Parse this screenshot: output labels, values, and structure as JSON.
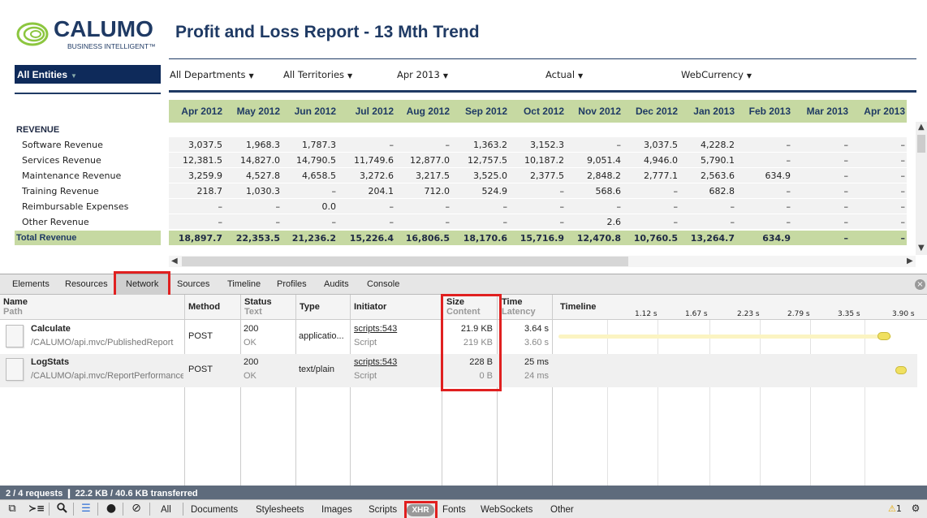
{
  "logo": {
    "word": "CALUMO",
    "sub": "BUSINESS INTELLIGENT™"
  },
  "report": {
    "title": "Profit and Loss Report - 13 Mth Trend",
    "entities": "All Entities",
    "filters": [
      "All Departments",
      "All Territories",
      "Apr 2013",
      "Actual",
      "WebCurrency"
    ],
    "months": [
      "Apr 2012",
      "May 2012",
      "Jun 2012",
      "Jul 2012",
      "Aug 2012",
      "Sep 2012",
      "Oct 2012",
      "Nov 2012",
      "Dec 2012",
      "Jan 2013",
      "Feb 2013",
      "Mar 2013",
      "Apr 2013"
    ],
    "section": "REVENUE",
    "rows": [
      {
        "label": "Software Revenue",
        "values": [
          "3,037.5",
          "1,968.3",
          "1,787.3",
          "–",
          "–",
          "1,363.2",
          "3,152.3",
          "–",
          "3,037.5",
          "4,228.2",
          "–",
          "–",
          "–"
        ]
      },
      {
        "label": "Services Revenue",
        "values": [
          "12,381.5",
          "14,827.0",
          "14,790.5",
          "11,749.6",
          "12,877.0",
          "12,757.5",
          "10,187.2",
          "9,051.4",
          "4,946.0",
          "5,790.1",
          "–",
          "–",
          "–"
        ]
      },
      {
        "label": "Maintenance Revenue",
        "values": [
          "3,259.9",
          "4,527.8",
          "4,658.5",
          "3,272.6",
          "3,217.5",
          "3,525.0",
          "2,377.5",
          "2,848.2",
          "2,777.1",
          "2,563.6",
          "634.9",
          "–",
          "–"
        ]
      },
      {
        "label": "Training Revenue",
        "values": [
          "218.7",
          "1,030.3",
          "–",
          "204.1",
          "712.0",
          "524.9",
          "–",
          "568.6",
          "–",
          "682.8",
          "–",
          "–",
          "–"
        ]
      },
      {
        "label": "Reimbursable Expenses",
        "values": [
          "–",
          "–",
          "0.0",
          "–",
          "–",
          "–",
          "–",
          "–",
          "–",
          "–",
          "–",
          "–",
          "–"
        ]
      },
      {
        "label": "Other Revenue",
        "values": [
          "–",
          "–",
          "–",
          "–",
          "–",
          "–",
          "–",
          "2.6",
          "–",
          "–",
          "–",
          "–",
          "–"
        ]
      }
    ],
    "total": {
      "label": "Total Revenue",
      "values": [
        "18,897.7",
        "22,353.5",
        "21,236.2",
        "15,226.4",
        "16,806.5",
        "18,170.6",
        "15,716.9",
        "12,470.8",
        "10,760.5",
        "13,264.7",
        "634.9",
        "–",
        "–"
      ]
    }
  },
  "devtools": {
    "tabs": [
      "Elements",
      "Resources",
      "Network",
      "Sources",
      "Timeline",
      "Profiles",
      "Audits",
      "Console"
    ],
    "active_tab": "Network",
    "columns": {
      "name": "Name",
      "path": "Path",
      "method": "Method",
      "status": "Status",
      "status_text": "Text",
      "type": "Type",
      "initiator": "Initiator",
      "size": "Size",
      "content": "Content",
      "time": "Time",
      "latency": "Latency",
      "timeline": "Timeline"
    },
    "ticks": [
      "1.12 s",
      "1.67 s",
      "2.23 s",
      "2.79 s",
      "3.35 s",
      "3.90 s"
    ],
    "requests": [
      {
        "name": "Calculate",
        "path": "/CALUMO/api.mvc/PublishedReport",
        "method": "POST",
        "status": "200",
        "status_text": "OK",
        "type": "applicatio...",
        "initiator": "scripts:543",
        "initiator_type": "Script",
        "size": "21.9 KB",
        "content": "219 KB",
        "time": "3.64 s",
        "latency": "3.60 s",
        "progress": 1.0
      },
      {
        "name": "LogStats",
        "path": "/CALUMO/api.mvc/ReportPerformance",
        "method": "POST",
        "status": "200",
        "status_text": "OK",
        "type": "text/plain",
        "initiator": "scripts:543",
        "initiator_type": "Script",
        "size": "228 B",
        "content": "0 B",
        "time": "25 ms",
        "latency": "24 ms",
        "progress": 1.0
      }
    ],
    "summary": "2 / 4 requests  ❙  22.2 KB / 40.6 KB transferred",
    "filters": [
      "All",
      "Documents",
      "Stylesheets",
      "Images",
      "Scripts",
      "XHR",
      "Fonts",
      "WebSockets",
      "Other"
    ],
    "active_filter": "XHR",
    "warning_count": "1",
    "accent": "#e02020"
  }
}
